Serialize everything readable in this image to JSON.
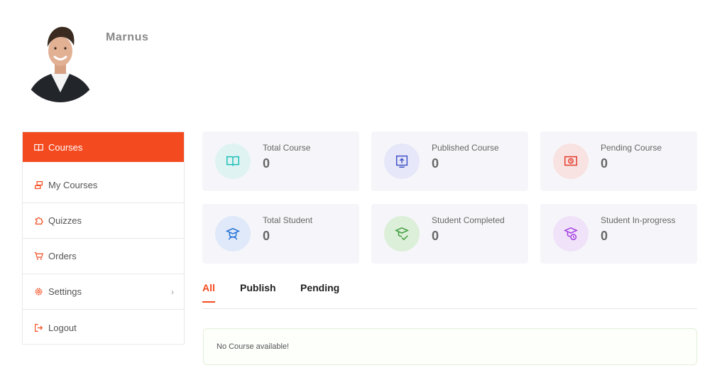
{
  "profile": {
    "username": "Marnus"
  },
  "sidebar": {
    "items": [
      {
        "label": "Courses",
        "icon": "book-icon",
        "active": true
      },
      {
        "label": "My Courses",
        "icon": "stack-icon",
        "active": false
      },
      {
        "label": "Quizzes",
        "icon": "puzzle-icon",
        "active": false
      },
      {
        "label": "Orders",
        "icon": "cart-icon",
        "active": false
      },
      {
        "label": "Settings",
        "icon": "gear-icon",
        "active": false,
        "has_submenu": true
      },
      {
        "label": "Logout",
        "icon": "logout-icon",
        "active": false
      }
    ],
    "chevron": "›"
  },
  "stats": [
    {
      "label": "Total Course",
      "value": "0",
      "icon": "open-book-icon",
      "color": "#1bbfb7",
      "bg": "#dff3f3"
    },
    {
      "label": "Published Course",
      "value": "0",
      "icon": "upload-book-icon",
      "color": "#3d50c8",
      "bg": "#e6e7f8"
    },
    {
      "label": "Pending Course",
      "value": "0",
      "icon": "pending-book-icon",
      "color": "#e33b2a",
      "bg": "#f8e2e2"
    },
    {
      "label": "Total Student",
      "value": "0",
      "icon": "graduate-icon",
      "color": "#1f6fd6",
      "bg": "#dfe9f9"
    },
    {
      "label": "Student Completed",
      "value": "0",
      "icon": "graduate-check-icon",
      "color": "#3d9c3b",
      "bg": "#dcefd9"
    },
    {
      "label": "Student In-progress",
      "value": "0",
      "icon": "graduate-clock-icon",
      "color": "#a23ee0",
      "bg": "#f0e2f8"
    }
  ],
  "tabs": [
    {
      "label": "All",
      "active": true
    },
    {
      "label": "Publish",
      "active": false
    },
    {
      "label": "Pending",
      "active": false
    }
  ],
  "empty_message": "No Course available!",
  "colors": {
    "accent": "#f44a1f"
  }
}
